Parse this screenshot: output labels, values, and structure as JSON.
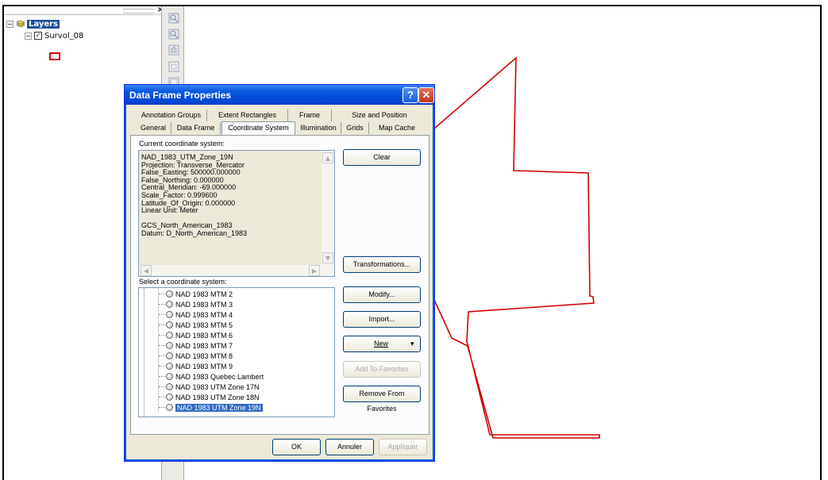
{
  "toc": {
    "close_glyph": "×",
    "layers_label": "Layers",
    "layer_name": "Survol_08",
    "expand_glyph": "⊟",
    "check_glyph": "✓"
  },
  "tools": [
    "zoom-in-icon",
    "zoom-out-icon",
    "pan-icon",
    "full-extent-icon",
    "fixed-zoom-icon"
  ],
  "dialog": {
    "title": "Data Frame Properties",
    "help_glyph": "?",
    "close_glyph": "✕",
    "tabs_row1": [
      "Annotation Groups",
      "Extent Rectangles",
      "Frame",
      "Size and Position"
    ],
    "tabs_row2": [
      "General",
      "Data Frame",
      "Coordinate System",
      "Illumination",
      "Grids",
      "Map Cache"
    ],
    "active_tab": "Coordinate System",
    "current_label": "Current coordinate system:",
    "current_lines": [
      "NAD_1983_UTM_Zone_19N",
      "Projection: Transverse_Mercator",
      "False_Easting: 500000.000000",
      "False_Northing: 0.000000",
      "Central_Meridian: -69.000000",
      "Scale_Factor: 0.999600",
      "Latitude_Of_Origin: 0.000000",
      "Linear Unit: Meter",
      "",
      "GCS_North_American_1983",
      "Datum: D_North_American_1983"
    ],
    "select_label": "Select a coordinate system:",
    "list_items": [
      "NAD 1983 MTM 2",
      "NAD 1983 MTM 3",
      "NAD 1983 MTM 4",
      "NAD 1983 MTM 5",
      "NAD 1983 MTM 6",
      "NAD 1983 MTM 7",
      "NAD 1983 MTM 8",
      "NAD 1983 MTM 9",
      "NAD 1983 Quebec Lambert",
      "NAD 1983 UTM Zone 17N",
      "NAD 1983 UTM Zone 18N",
      "NAD 1983 UTM Zone 19N"
    ],
    "selected_item": "NAD 1983 UTM Zone 19N",
    "buttons": {
      "clear": "Clear",
      "transformations": "Transformations...",
      "modify": "Modify...",
      "import": "Import...",
      "new": "New",
      "new_arrow": "▾",
      "add_favorites": "Add To Favorites",
      "remove_favorites": "Remove From Favorites",
      "ok": "OK",
      "cancel": "Annuler",
      "apply": "Appliquer"
    }
  },
  "map": {
    "polygon_color": "#d40000"
  }
}
